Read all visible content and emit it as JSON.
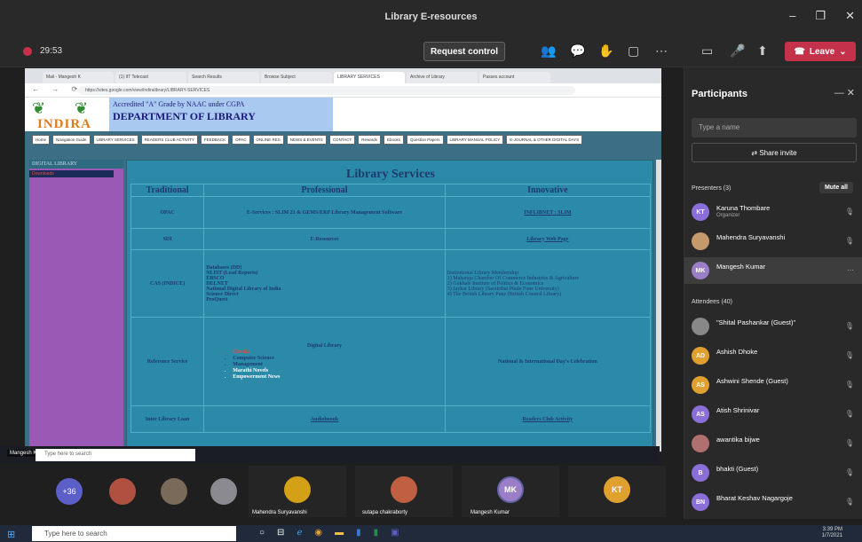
{
  "window": {
    "title": "Library E-resources"
  },
  "toolbar": {
    "timer": "29:53",
    "request_control": "Request control",
    "leave": "Leave"
  },
  "browser": {
    "tabs": [
      "Mail - Mangesh K",
      "(1) IIT Telecast",
      "Search Results",
      "Browse Subject",
      "LIBRARY SERVICES",
      "Archive of Library",
      "Passes account"
    ],
    "url": "https://sites.google.com/view/indiralibrary/LIBRARY-SERVICES"
  },
  "site": {
    "logo_text": "INDIRA",
    "naac": "Accredited \"A\" Grade by NAAC under CGPA",
    "dept": "DEPARTMENT OF LIBRARY",
    "nav": [
      "Home",
      "Navigation Guide",
      "LIBRARY SERVICES",
      "READERS CLUB ACTIVITY",
      "FEEDBACK",
      "OPAC",
      "ONLINE RES",
      "NEWS & EVENTS",
      "CONTACT",
      "Rewards",
      "Ebooks",
      "Question Papers",
      "LIBRARY MANUAL POLICY",
      "E-JOURNAL & OTHER DIGITAL DAYS"
    ],
    "side_title": "DIGITAL LIBRARY",
    "side_item": "Downloads",
    "section_title": "Library Services",
    "cols": [
      "Traditional",
      "Professional",
      "Innovative"
    ],
    "rows": [
      {
        "a": "OPAC",
        "b": "E-Services : SLIM 21 & GEMS/ERP Library Management Software",
        "c": "INFLIBNET : SLIM"
      },
      {
        "a": "SDI",
        "b": "E-Resources",
        "c": "Library Web Page"
      },
      {
        "a": "CAS (INDICE)",
        "b": "Databases (DD)\nNLIST (Lead Reports)\nEBSCO\nDELNET\nNational Digital Library of India\nScience Direct\nProQuest",
        "c": "Institutional Library Membership\n1) Maharaja Chamber Of Commerce Industries & Agriculture\n2) Gokhale Institute of Politics & Economics\n3) Jaykar Library (Savitribai Phule Pune University)\n4) The British Library Pune (British Council Library)"
      },
      {
        "a": "Reference Service",
        "b": "Digital Library",
        "c": "National & International Day's Celebration"
      },
      {
        "a": "Inter Library Loan",
        "b": "Audioboook",
        "c": "Readers Club Activity"
      }
    ],
    "digital": [
      "Ebooks",
      "Computer Science",
      "Management",
      "Marathi Novels",
      "Empowerment News"
    ]
  },
  "inner_taskbar": {
    "presenter": "Mangesh Kumar",
    "search": "Type here to search"
  },
  "tiles": [
    {
      "label": "+36"
    },
    {
      "label": ""
    },
    {
      "label": ""
    },
    {
      "label": ""
    },
    {
      "label": "Mahendra Suryavanshi"
    },
    {
      "label": "sutapa chakraborty"
    },
    {
      "label": "Mangesh Kumar",
      "initials": "MK"
    },
    {
      "initials": "KT"
    }
  ],
  "panel": {
    "title": "Participants",
    "search_placeholder": "Type a name",
    "share_invite": "Share invite",
    "presenters_label": "Presenters (3)",
    "mute_all": "Mute all",
    "attendees_label": "Attendees (40)",
    "presenters": [
      {
        "name": "Karuna Thombare",
        "sub": "Organizer",
        "initials": "KT",
        "color": "#8b6fd8"
      },
      {
        "name": "Mahendra Suryavanshi",
        "sub": "",
        "initials": "",
        "color": "#c49a6c"
      },
      {
        "name": "Mangesh Kumar",
        "sub": "",
        "initials": "MK",
        "color": "#9b7ec8"
      }
    ],
    "attendees": [
      {
        "name": "\"Shital Pashankar (Guest)\"",
        "initials": "",
        "color": "#888"
      },
      {
        "name": "Ashish Dhoke",
        "initials": "AD",
        "color": "#e0a030"
      },
      {
        "name": "Ashwini Shende (Guest)",
        "initials": "AS",
        "color": "#e0a030"
      },
      {
        "name": "Atish Shrinivar",
        "initials": "AS",
        "color": "#8b6fd8"
      },
      {
        "name": "awantika bijwe",
        "initials": "",
        "color": "#b07070"
      },
      {
        "name": "bhakti (Guest)",
        "initials": "B",
        "color": "#8b6fd8"
      },
      {
        "name": "Bharat Keshav Nagargoje",
        "initials": "BN",
        "color": "#8b6fd8"
      }
    ]
  },
  "taskbar": {
    "search": "Type here to search",
    "time": "3:39 PM",
    "date": "1/7/2021"
  }
}
